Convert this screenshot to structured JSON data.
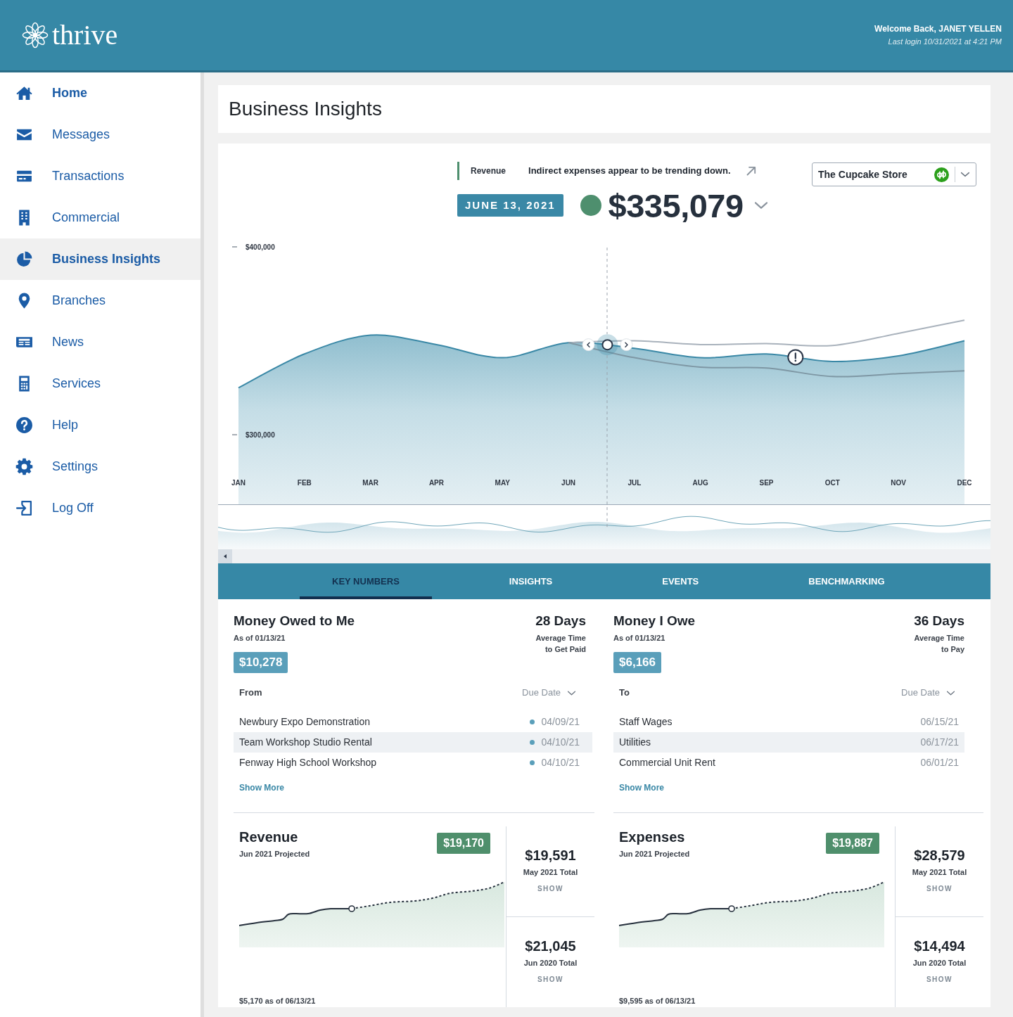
{
  "header": {
    "logo": "thrive",
    "welcome": "Welcome Back, JANET YELLEN",
    "last_login": "Last login 10/31/2021 at 4:21 PM"
  },
  "sidebar": {
    "items": [
      {
        "label": "Home",
        "bold": true,
        "selected": false
      },
      {
        "label": "Messages",
        "bold": false,
        "selected": false
      },
      {
        "label": "Transactions",
        "bold": false,
        "selected": false
      },
      {
        "label": "Commercial",
        "bold": false,
        "selected": false
      },
      {
        "label": "Business Insights",
        "bold": true,
        "selected": true
      },
      {
        "label": "Branches",
        "bold": false,
        "selected": false
      },
      {
        "label": "News",
        "bold": false,
        "selected": false
      },
      {
        "label": "Services",
        "bold": false,
        "selected": false
      },
      {
        "label": "Help",
        "bold": false,
        "selected": false
      },
      {
        "label": "Settings",
        "bold": false,
        "selected": false
      },
      {
        "label": "Log Off",
        "bold": false,
        "selected": false
      }
    ]
  },
  "page_title": "Business Insights",
  "insight": {
    "label": "Revenue",
    "message": "Indirect expenses appear to be trending down."
  },
  "store_select": {
    "value": "The Cupcake Store"
  },
  "summary": {
    "date": "JUNE 13, 2021",
    "value": "$335,079"
  },
  "chart": {
    "chart_data": {
      "type": "area",
      "categories": [
        "JAN",
        "FEB",
        "MAR",
        "APR",
        "MAY",
        "JUN",
        "JUL",
        "AUG",
        "SEP",
        "OCT",
        "NOV",
        "DEC"
      ],
      "ylim": [
        263000,
        400000
      ],
      "yticks": [
        {
          "value": 400000,
          "label": "$400,000"
        },
        {
          "value": 300000,
          "label": "$300,000"
        }
      ],
      "series": [
        {
          "type": "area",
          "color": "#3a88a6",
          "values": [
            325000,
            343000,
            353000,
            348000,
            341000,
            349000,
            346000,
            341000,
            343000,
            339000,
            342000,
            350000
          ]
        },
        {
          "type": "line",
          "color": "#a9b2bc",
          "values": [
            null,
            null,
            null,
            null,
            null,
            349000,
            350000,
            348000,
            348500,
            347500,
            354000,
            361000
          ]
        },
        {
          "type": "line",
          "color": "#7e97a4",
          "values": [
            null,
            null,
            null,
            null,
            null,
            349000,
            341000,
            336000,
            335500,
            331000,
            332500,
            334000
          ]
        }
      ]
    }
  },
  "tabs": [
    {
      "label": "KEY NUMBERS",
      "selected": true
    },
    {
      "label": "INSIGHTS",
      "selected": false
    },
    {
      "label": "EVENTS",
      "selected": false
    },
    {
      "label": "BENCHMARKING",
      "selected": false
    }
  ],
  "key_numbers": [
    {
      "title": "Money Owed to Me",
      "as_of": "As of 01/13/21",
      "days": "28 Days",
      "days_caption": "Average Time to Get Paid",
      "amount": "$10,278",
      "party_header": "From",
      "sort_label": "Due Date",
      "rows": [
        {
          "name": "Newbury Expo Demonstration",
          "date": "04/09/21",
          "marked": true,
          "selected": false
        },
        {
          "name": "Team Workshop Studio Rental",
          "date": "04/10/21",
          "marked": true,
          "selected": true
        },
        {
          "name": "Fenway High School Workshop",
          "date": "04/10/21",
          "marked": true,
          "selected": false
        }
      ],
      "more": "Show More"
    },
    {
      "title": "Money I Owe",
      "as_of": "As of 01/13/21",
      "days": "36 Days",
      "days_caption": "Average Time to Pay",
      "amount": "$6,166",
      "party_header": "To",
      "sort_label": "Due Date",
      "rows": [
        {
          "name": "Staff Wages",
          "date": "06/15/21",
          "marked": false,
          "selected": false
        },
        {
          "name": "Utilities",
          "date": "06/17/21",
          "marked": false,
          "selected": true
        },
        {
          "name": "Commercial Unit Rent",
          "date": "06/01/21",
          "marked": false,
          "selected": false
        }
      ],
      "more": "Show More"
    }
  ],
  "totals": [
    {
      "title": "Revenue",
      "subtitle": "Jun 2021 Projected",
      "projected": "$19,170",
      "footnote": "$5,170 as of 06/13/21",
      "stats": [
        {
          "value": "$19,591",
          "caption": "May 2021 Total",
          "action": "SHOW"
        },
        {
          "value": "$21,045",
          "caption": "Jun 2020 Total",
          "action": "SHOW"
        }
      ]
    },
    {
      "title": "Expenses",
      "subtitle": "Jun 2021 Projected",
      "projected": "$19,887",
      "footnote": "$9,595 as of 06/13/21",
      "stats": [
        {
          "value": "$28,579",
          "caption": "May 2021 Total",
          "action": "SHOW"
        },
        {
          "value": "$14,494",
          "caption": "Jun 2020 Total",
          "action": "SHOW"
        }
      ]
    }
  ]
}
